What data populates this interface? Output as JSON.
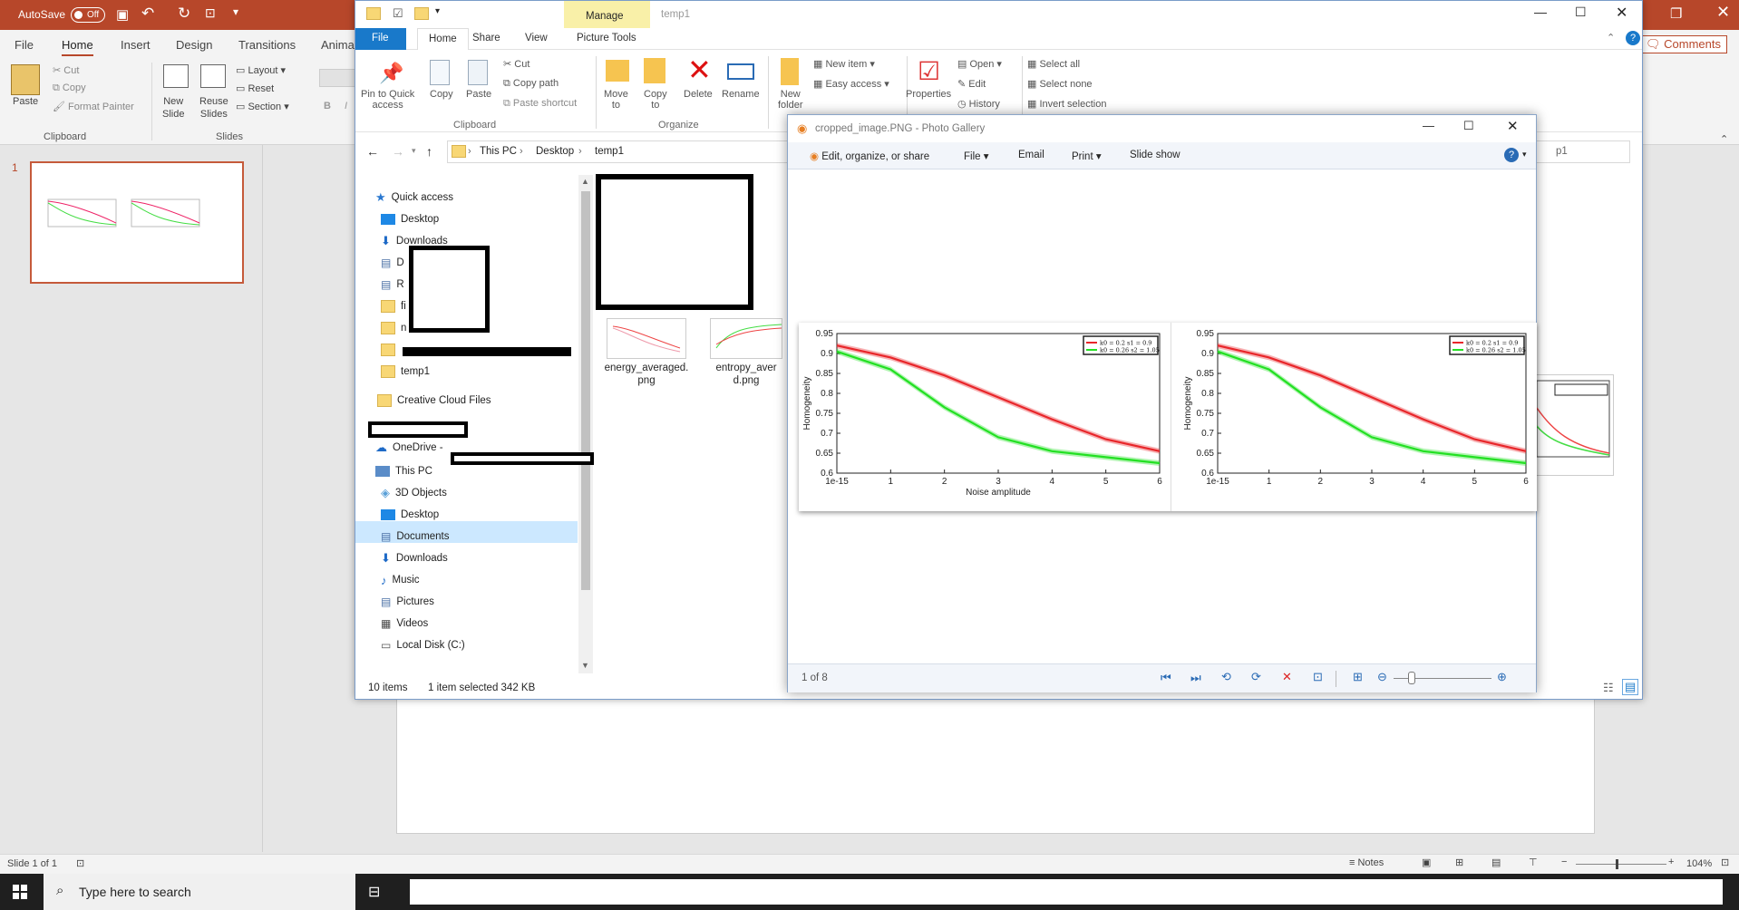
{
  "powerpoint": {
    "autosave_label": "AutoSave",
    "autosave_state": "Off",
    "tabs": [
      "File",
      "Home",
      "Insert",
      "Design",
      "Transitions",
      "Anima"
    ],
    "comments_label": "Comments",
    "clipboard": {
      "paste": "Paste",
      "cut": "Cut",
      "copy": "Copy",
      "format_painter": "Format Painter",
      "group": "Clipboard"
    },
    "slides": {
      "new_slide": "New\nSlide",
      "reuse_slides": "Reuse\nSlides",
      "layout": "Layout",
      "reset": "Reset",
      "section": "Section",
      "group": "Slides"
    },
    "font_bold": "B",
    "font_italic": "I",
    "thumbnail_number": "1",
    "status": {
      "slide": "Slide 1 of 1",
      "notes": "Notes",
      "zoom": "104%"
    }
  },
  "taskbar": {
    "search_placeholder": "Type here to search"
  },
  "explorer": {
    "title": "temp1",
    "manage_tab": "Manage",
    "tabs": [
      "File",
      "Home",
      "Share",
      "View",
      "Picture Tools"
    ],
    "ribbon": {
      "pin": "Pin to Quick\naccess",
      "copy": "Copy",
      "paste": "Paste",
      "cut": "Cut",
      "copy_path": "Copy path",
      "paste_shortcut": "Paste shortcut",
      "move_to": "Move\nto",
      "copy_to": "Copy\nto",
      "delete": "Delete",
      "rename": "Rename",
      "new_item": "New item",
      "easy_access": "Easy access",
      "new_folder": "New\nfolder",
      "properties": "Properties",
      "open": "Open",
      "edit": "Edit",
      "history": "History",
      "select_all": "Select all",
      "select_none": "Select none",
      "invert_selection": "Invert selection",
      "group_clipboard": "Clipboard",
      "group_organize": "Organize"
    },
    "breadcrumb": [
      "This PC",
      "Desktop",
      "temp1"
    ],
    "search_fragment": "p1",
    "nav": {
      "quick_access": "Quick access",
      "desktop_pinned": "Desktop",
      "downloads_pinned": "Downloads",
      "d_item": "D",
      "r_item": "R",
      "fi_item": "fi",
      "n_item": "n",
      "temp1": "temp1",
      "creative_cloud": "Creative Cloud Files",
      "onedrive": "OneDrive -",
      "this_pc": "This PC",
      "objects3d": "3D Objects",
      "desktop": "Desktop",
      "documents": "Documents",
      "downloads": "Downloads",
      "music": "Music",
      "pictures": "Pictures",
      "videos": "Videos",
      "local_disk": "Local Disk (C:)"
    },
    "files": [
      {
        "name": "energy_averaged.\npng"
      },
      {
        "name": "entropy_aver\nd.png"
      }
    ],
    "status": {
      "items": "10 items",
      "selected": "1 item selected  342 KB"
    }
  },
  "photo_gallery": {
    "title": "cropped_image.PNG - Photo Gallery",
    "menu": {
      "edit": "Edit, organize, or share",
      "file": "File",
      "email": "Email",
      "print": "Print",
      "slideshow": "Slide show"
    },
    "counter": "1 of 8"
  },
  "chart_data": [
    {
      "type": "line",
      "xlabel": "Noise amplitude",
      "ylabel": "Homogeneity",
      "x_tick_labels": [
        "1e-15",
        "1",
        "2",
        "3",
        "4",
        "5",
        "6"
      ],
      "y_tick_labels": [
        "0.6",
        "0.65",
        "0.7",
        "0.75",
        "0.8",
        "0.85",
        "0.9",
        "0.95"
      ],
      "ylim": [
        0.6,
        0.95
      ],
      "legend_position": "top-right",
      "series": [
        {
          "name": "k0 = 0.2  s1 = 0.9",
          "color": "#e8262a",
          "values": [
            0.92,
            0.89,
            0.845,
            0.79,
            0.735,
            0.685,
            0.655
          ]
        },
        {
          "name": "k0 = 0.26  s2 = 1.05",
          "color": "#22e022",
          "values": [
            0.905,
            0.86,
            0.765,
            0.69,
            0.655,
            0.64,
            0.625
          ]
        }
      ]
    },
    {
      "type": "line",
      "xlabel": "",
      "ylabel": "Homogeneity",
      "x_tick_labels": [
        "1e-15",
        "1",
        "2",
        "3",
        "4",
        "5",
        "6"
      ],
      "y_tick_labels": [
        "0.6",
        "0.65",
        "0.7",
        "0.75",
        "0.8",
        "0.85",
        "0.9",
        "0.95"
      ],
      "ylim": [
        0.6,
        0.95
      ],
      "legend_position": "top-right",
      "series": [
        {
          "name": "k0 = 0.2  s1 = 0.9",
          "color": "#e8262a",
          "values": [
            0.92,
            0.89,
            0.845,
            0.79,
            0.735,
            0.685,
            0.655
          ]
        },
        {
          "name": "k0 = 0.26  s2 = 1.05",
          "color": "#22e022",
          "values": [
            0.905,
            0.86,
            0.765,
            0.69,
            0.655,
            0.64,
            0.625
          ]
        }
      ]
    }
  ]
}
